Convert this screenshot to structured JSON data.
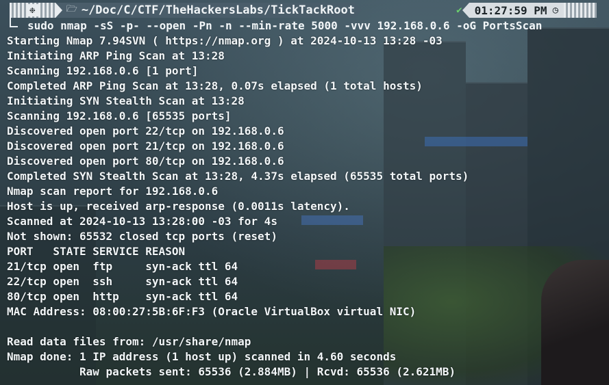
{
  "status_bar": {
    "os_icon": "linux-penguin-icon",
    "folder_icon": "folder-icon",
    "path": "~/Doc/C/CTF/TheHackersLabs/TickTackRoot",
    "status_icon": "check-icon",
    "time": "01:27:59 PM",
    "clock_icon": "clock-icon"
  },
  "prompt": {
    "command": "sudo nmap -sS -p- --open -Pn -n --min-rate 5000 -vvv 192.168.0.6 -oG PortsScan"
  },
  "output": [
    "Starting Nmap 7.94SVN ( https://nmap.org ) at 2024-10-13 13:28 -03",
    "Initiating ARP Ping Scan at 13:28",
    "Scanning 192.168.0.6 [1 port]",
    "Completed ARP Ping Scan at 13:28, 0.07s elapsed (1 total hosts)",
    "Initiating SYN Stealth Scan at 13:28",
    "Scanning 192.168.0.6 [65535 ports]",
    "Discovered open port 22/tcp on 192.168.0.6",
    "Discovered open port 21/tcp on 192.168.0.6",
    "Discovered open port 80/tcp on 192.168.0.6",
    "Completed SYN Stealth Scan at 13:28, 4.37s elapsed (65535 total ports)",
    "Nmap scan report for 192.168.0.6",
    "Host is up, received arp-response (0.0011s latency).",
    "Scanned at 2024-10-13 13:28:00 -03 for 4s",
    "Not shown: 65532 closed tcp ports (reset)",
    "PORT   STATE SERVICE REASON",
    "21/tcp open  ftp     syn-ack ttl 64",
    "22/tcp open  ssh     syn-ack ttl 64",
    "80/tcp open  http    syn-ack ttl 64",
    "MAC Address: 08:00:27:5B:6F:F3 (Oracle VirtualBox virtual NIC)",
    "",
    "Read data files from: /usr/share/nmap",
    "Nmap done: 1 IP address (1 host up) scanned in 4.60 seconds",
    "           Raw packets sent: 65536 (2.884MB) | Rcvd: 65536 (2.621MB)"
  ]
}
